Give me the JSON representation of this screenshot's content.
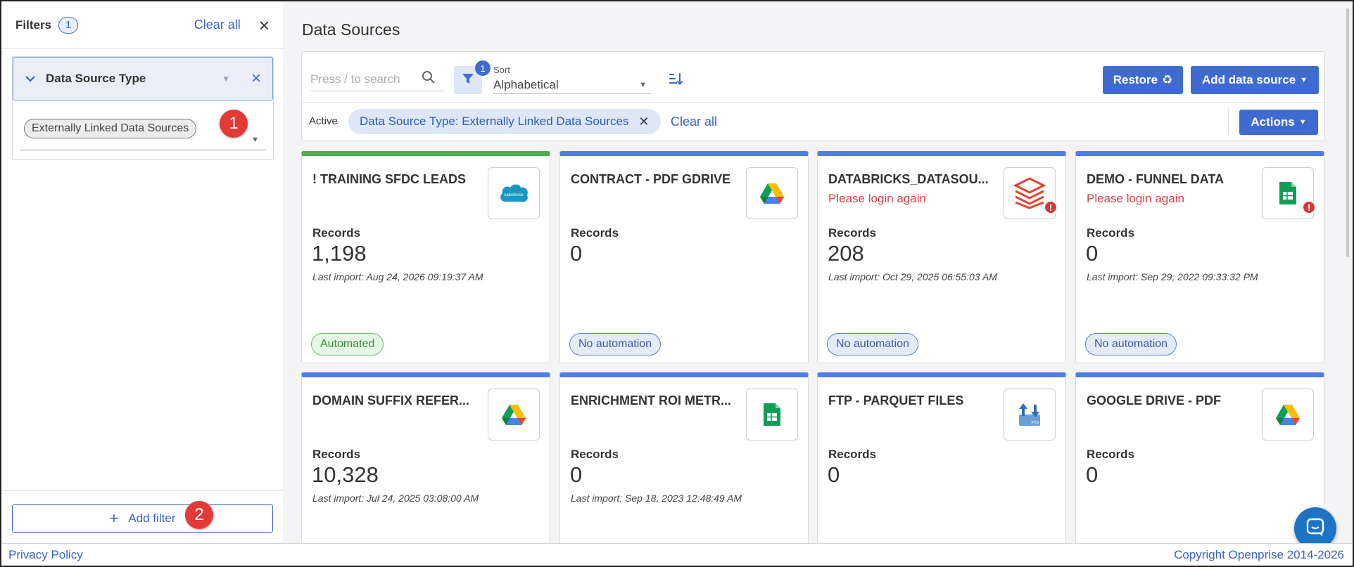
{
  "filters": {
    "title": "Filters",
    "count": "1",
    "clear_all": "Clear all",
    "group": {
      "title": "Data Source Type",
      "selected": "Externally Linked Data Sources"
    },
    "add_filter": "Add filter"
  },
  "markers": [
    "1",
    "2"
  ],
  "main": {
    "title": "Data Sources",
    "search_placeholder": "Press / to search",
    "filter_count": "1",
    "sort_label": "Sort",
    "sort_value": "Alphabetical",
    "restore": "Restore",
    "add_data_source": "Add data source",
    "active_label": "Active",
    "active_chip": "Data Source Type: Externally Linked Data Sources",
    "clear_all": "Clear all",
    "actions": "Actions"
  },
  "records_label": "Records",
  "cards": [
    {
      "name": "! TRAINING SFDC LEADS",
      "error": "",
      "records": "1,198",
      "last_import": "Last import: Aug 24, 2026 09:19:37 AM",
      "automation": "Automated",
      "icon": "salesforce-icon",
      "status": "green"
    },
    {
      "name": "CONTRACT - PDF GDRIVE",
      "error": "",
      "records": "0",
      "last_import": "",
      "automation": "No automation",
      "icon": "google-drive-icon",
      "status": "blue"
    },
    {
      "name": "DATABRICKS_DATASOU...",
      "error": "Please login again",
      "records": "208",
      "last_import": "Last import: Oct 29, 2025 06:55:03 AM",
      "automation": "No automation",
      "icon": "databricks-icon",
      "status": "blue"
    },
    {
      "name": "DEMO - FUNNEL DATA",
      "error": "Please login again",
      "records": "0",
      "last_import": "Last import: Sep 29, 2022 09:33:32 PM",
      "automation": "No automation",
      "icon": "google-sheets-icon",
      "status": "blue"
    },
    {
      "name": "DOMAIN SUFFIX REFER...",
      "error": "",
      "records": "10,328",
      "last_import": "Last import: Jul 24, 2025 03:08:00 AM",
      "automation": "",
      "icon": "google-drive-icon",
      "status": "blue"
    },
    {
      "name": "ENRICHMENT ROI METR...",
      "error": "",
      "records": "0",
      "last_import": "Last import: Sep 18, 2023 12:48:49 AM",
      "automation": "",
      "icon": "google-sheets-icon",
      "status": "blue"
    },
    {
      "name": "FTP - PARQUET FILES",
      "error": "",
      "records": "0",
      "last_import": "",
      "automation": "",
      "icon": "ftp-icon",
      "status": "blue"
    },
    {
      "name": "GOOGLE DRIVE - PDF",
      "error": "",
      "records": "0",
      "last_import": "",
      "automation": "",
      "icon": "google-drive-icon",
      "status": "blue"
    }
  ],
  "footer": {
    "privacy": "Privacy Policy",
    "copyright": "Copyright Openprise 2014-2026"
  },
  "colors": {
    "primary": "#3f6bd1",
    "link": "#3b63b8",
    "automated": "#4caf50",
    "error": "#d04545",
    "marker": "#e33a37"
  }
}
